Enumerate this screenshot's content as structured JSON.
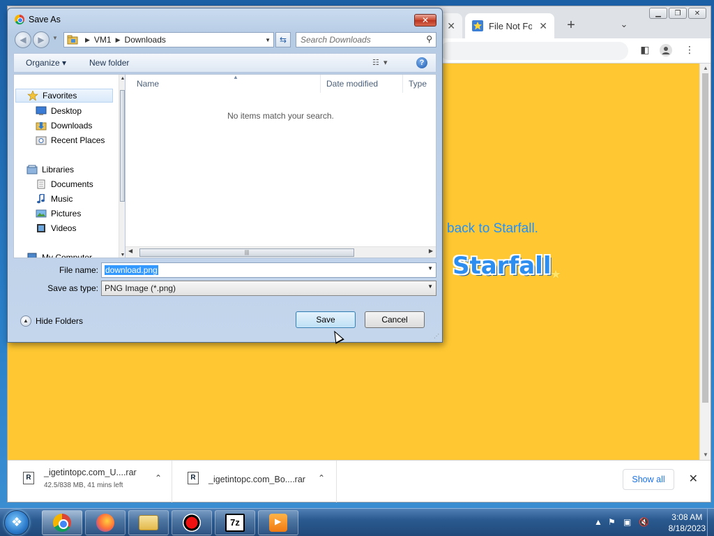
{
  "browser": {
    "tabs": [
      {
        "label": "",
        "active": false
      },
      {
        "label": "File Not Fou",
        "active": true
      }
    ],
    "new_tab_symbol": "+",
    "page": {
      "back_link": "back to Starfall.",
      "logo_text": "Starfall",
      "background_color": "#ffc832",
      "link_color": "#1e90ff"
    },
    "downloads": [
      {
        "name": "_igetintopc.com_U....rar",
        "status": "42.5/838 MB, 41 mins left"
      },
      {
        "name": "_igetintopc.com_Bo....rar",
        "status": ""
      }
    ],
    "show_all_label": "Show all"
  },
  "dialog": {
    "title": "Save As",
    "breadcrumb": [
      "VM1",
      "Downloads"
    ],
    "search_placeholder": "Search Downloads",
    "commands": {
      "organize": "Organize",
      "new_folder": "New folder"
    },
    "nav": {
      "favorites": "Favorites",
      "favorites_items": [
        "Desktop",
        "Downloads",
        "Recent Places"
      ],
      "libraries": "Libraries",
      "libraries_items": [
        "Documents",
        "Music",
        "Pictures",
        "Videos"
      ],
      "computer": "My Computer"
    },
    "columns": [
      "Name",
      "Date modified",
      "Type"
    ],
    "empty_message": "No items match your search.",
    "file_name_label": "File name:",
    "file_name_value": "download.png",
    "save_type_label": "Save as type:",
    "save_type_value": "PNG Image (*.png)",
    "hide_folders_label": "Hide Folders",
    "save_label": "Save",
    "cancel_label": "Cancel"
  },
  "taskbar": {
    "apps": [
      "chrome-icon",
      "firefox-icon",
      "explorer-icon",
      "recorder-icon",
      "7zip-icon",
      "media-player-icon"
    ],
    "seven_zip_text": "7z",
    "time": "3:08 AM",
    "date": "8/18/2023"
  }
}
